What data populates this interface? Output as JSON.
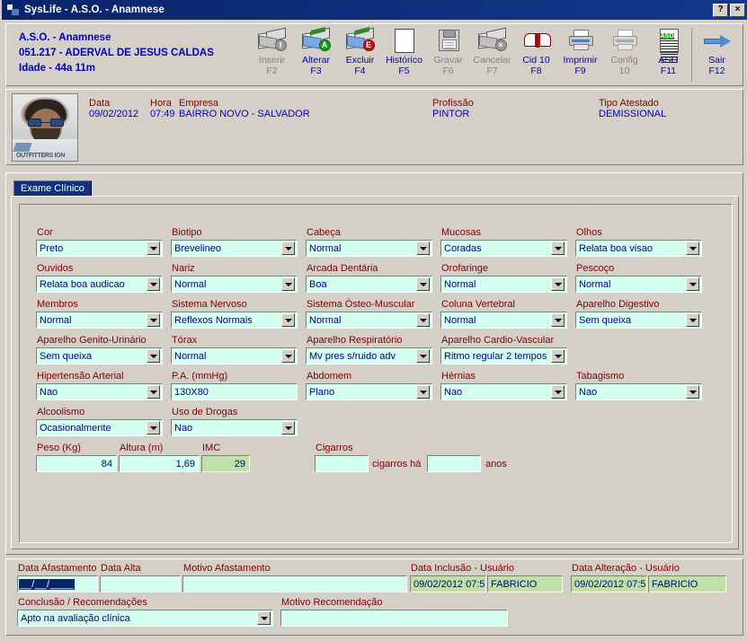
{
  "window": {
    "title": "SysLife - A.S.O. - Anamnese",
    "help_button": "?",
    "close_button": "×"
  },
  "header": {
    "line1": "A.S.O. - Anamnese",
    "line2": "051.217 - ADERVAL DE JESUS CALDAS",
    "line3": "Idade - 44a 11m"
  },
  "toolbar": {
    "buttons": [
      {
        "label": "Inserir",
        "key": "F2",
        "icon": "insert-record-icon",
        "enabled": false
      },
      {
        "label": "Alterar",
        "key": "F3",
        "icon": "edit-record-icon",
        "enabled": true
      },
      {
        "label": "Excluir",
        "key": "F4",
        "icon": "delete-record-icon",
        "enabled": true
      },
      {
        "label": "Histórico",
        "key": "F5",
        "icon": "history-grid-icon",
        "enabled": true
      },
      {
        "label": "Gravar",
        "key": "F6",
        "icon": "save-diskette-icon",
        "enabled": false
      },
      {
        "label": "Cancelar",
        "key": "F7",
        "icon": "cancel-record-icon",
        "enabled": false
      },
      {
        "label": "Cid 10",
        "key": "F8",
        "icon": "book-icon",
        "enabled": true
      },
      {
        "label": "Imprimir",
        "key": "F9",
        "icon": "printer-icon",
        "enabled": true
      },
      {
        "label": "Config",
        "key": "10",
        "icon": "printer-config-icon",
        "enabled": false
      },
      {
        "label": "ASO",
        "key": "F11",
        "icon": "aso-document-icon",
        "enabled": true
      },
      {
        "label": "Sair",
        "key": "F12",
        "icon": "exit-arrow-icon",
        "enabled": true
      }
    ]
  },
  "patient": {
    "photo_alt": "patient-photo",
    "fields": [
      {
        "label": "Data",
        "value": "09/02/2012"
      },
      {
        "label": "Hora",
        "value": "07:49"
      },
      {
        "label": "Empresa",
        "value": "BAIRRO NOVO - SALVADOR"
      },
      {
        "label": "Profissão",
        "value": "PINTOR"
      },
      {
        "label": "Tipo Atestado",
        "value": "DEMISSIONAL"
      }
    ]
  },
  "tabs": [
    {
      "label": "Exame Clínico",
      "active": true
    }
  ],
  "exam": {
    "fields": [
      {
        "name": "cor",
        "label": "Cor",
        "value": "Preto",
        "type": "combo"
      },
      {
        "name": "biotipo",
        "label": "Biotipo",
        "value": "Brevelineo",
        "type": "combo"
      },
      {
        "name": "cabeca",
        "label": "Cabeça",
        "value": "Normal",
        "type": "combo"
      },
      {
        "name": "mucosas",
        "label": "Mucosas",
        "value": "Coradas",
        "type": "combo"
      },
      {
        "name": "olhos",
        "label": "Olhos",
        "value": "Relata boa visao",
        "type": "combo"
      },
      {
        "name": "ouvidos",
        "label": "Ouvidos",
        "value": "Relata boa audicao",
        "type": "combo"
      },
      {
        "name": "nariz",
        "label": "Nariz",
        "value": "Normal",
        "type": "combo"
      },
      {
        "name": "arcada-dentaria",
        "label": "Arcada Dentária",
        "value": "Boa",
        "type": "combo"
      },
      {
        "name": "orofaringe",
        "label": "Orofaringe",
        "value": "Normal",
        "type": "combo"
      },
      {
        "name": "pescoco",
        "label": "Pescoço",
        "value": "Normal",
        "type": "combo"
      },
      {
        "name": "membros",
        "label": "Membros",
        "value": "Normal",
        "type": "combo"
      },
      {
        "name": "sistema-nervoso",
        "label": "Sistema Nervoso",
        "value": "Reflexos Normais",
        "type": "combo"
      },
      {
        "name": "sistema-osteo-muscular",
        "label": "Sistema Ósteo-Muscular",
        "value": "Normal",
        "type": "combo"
      },
      {
        "name": "coluna-vertebral",
        "label": "Coluna Vertebral",
        "value": "Normal",
        "type": "combo"
      },
      {
        "name": "aparelho-digestivo",
        "label": "Aparelho Digestivo",
        "value": "Sem queixa",
        "type": "combo"
      },
      {
        "name": "aparelho-genito-urinario",
        "label": "Aparelho Genito-Urinário",
        "value": "Sem queixa",
        "type": "combo"
      },
      {
        "name": "torax",
        "label": "Tórax",
        "value": "Normal",
        "type": "combo"
      },
      {
        "name": "aparelho-respiratorio",
        "label": "Aparelho Respiratório",
        "value": "Mv pres s/ruido adv",
        "type": "combo"
      },
      {
        "name": "aparelho-cardio-vascular",
        "label": "Aparelho Cardio-Vascular",
        "value": "Ritmo regular 2 tempos",
        "type": "combo"
      },
      {
        "name": "hipertensao-arterial",
        "label": "Hipertensão Arterial",
        "value": "Nao",
        "type": "combo"
      },
      {
        "name": "pressao-arterial",
        "label": "P.A. (mmHg)",
        "value": "130X80",
        "type": "text"
      },
      {
        "name": "abdomem",
        "label": "Abdomem",
        "value": "Plano",
        "type": "combo"
      },
      {
        "name": "hernias",
        "label": "Hérnias",
        "value": "Nao",
        "type": "combo"
      },
      {
        "name": "tabagismo",
        "label": "Tabagismo",
        "value": "Nao",
        "type": "combo"
      },
      {
        "name": "alcoolismo",
        "label": "Alcoolismo",
        "value": "Ocasionalmente",
        "type": "combo"
      },
      {
        "name": "uso-de-drogas",
        "label": "Uso de Drogas",
        "value": "Nao",
        "type": "combo"
      }
    ],
    "measures": {
      "peso_label": "Peso (Kg)",
      "peso_value": "84",
      "altura_label": "Altura (m)",
      "altura_value": "1,69",
      "imc_label": "IMC",
      "imc_value": "29",
      "cigarros_label": "Cigarros",
      "cigarros_value": "",
      "cigarros_mid_label": "cigarros há",
      "anos_value": "",
      "anos_label": "anos"
    }
  },
  "footer": {
    "data_afastamento_label": "Data Afastamento",
    "data_afastamento_value": "__/__/____",
    "data_alta_label": "Data Alta",
    "data_alta_value": "",
    "motivo_afastamento_label": "Motivo Afastamento",
    "motivo_afastamento_value": "",
    "data_inclusao_label": "Data Inclusão - Usuário",
    "data_inclusao_value": "09/02/2012 07:5",
    "usuario_inclusao_value": "FABRICIO",
    "data_alteracao_label": "Data Alteração - Usuário",
    "data_alteracao_value": "09/02/2012 07:5",
    "usuario_alteracao_value": "FABRICIO",
    "conclusao_label": "Conclusão / Recomendações",
    "conclusao_value": "Apto na avaliação clínica",
    "motivo_recomendacao_label": "Motivo Recomendação",
    "motivo_recomendacao_value": ""
  },
  "colors": {
    "title_bar": "#0a246a",
    "face": "#d4d0c8",
    "label_red": "#800000",
    "value_blue": "#000080",
    "field_bg": "#d4fff0",
    "readonly_bg": "#c0e0a8"
  }
}
